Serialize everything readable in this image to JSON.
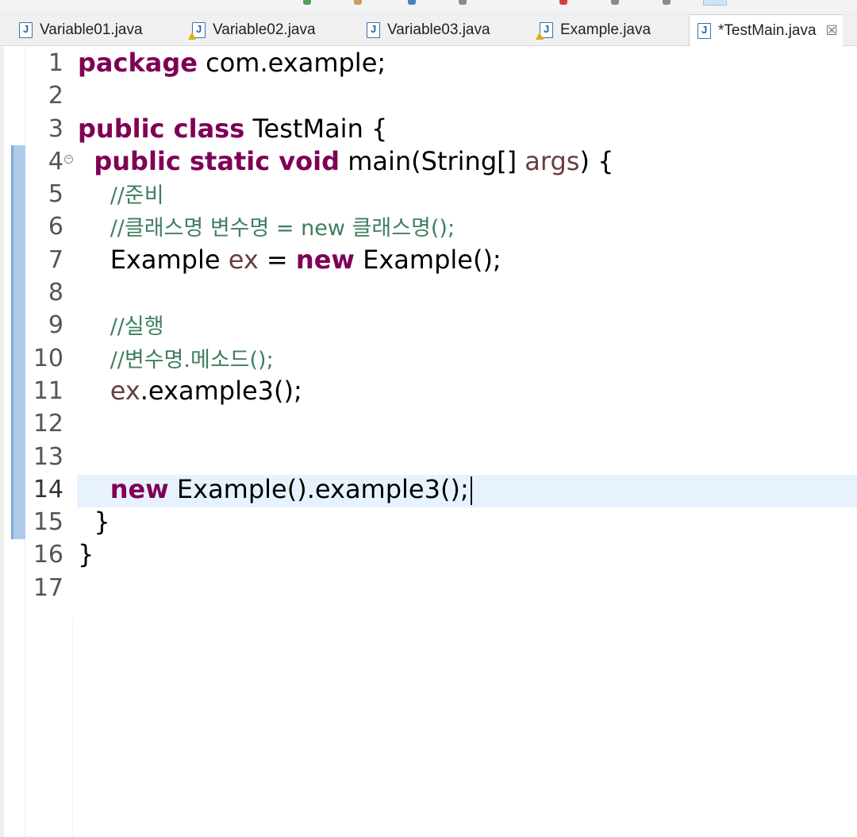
{
  "tabs": [
    {
      "label": "Variable01.java",
      "warning": false,
      "active": false
    },
    {
      "label": "Variable02.java",
      "warning": true,
      "active": false
    },
    {
      "label": "Variable03.java",
      "warning": false,
      "active": false
    },
    {
      "label": "Example.java",
      "warning": true,
      "active": false
    },
    {
      "label": "*TestMain.java",
      "warning": false,
      "active": true
    }
  ],
  "close_glyph": "☒",
  "line_numbers": [
    "1",
    "2",
    "3",
    "4",
    "5",
    "6",
    "7",
    "8",
    "9",
    "10",
    "11",
    "12",
    "13",
    "14",
    "15",
    "16",
    "17"
  ],
  "current_line": "14",
  "code": {
    "l1": {
      "kw": "package",
      "rest": " com.example;"
    },
    "l3": {
      "kw": "public class",
      "rest": " TestMain {"
    },
    "l4": {
      "kw": "public static void",
      "a": " main(String[] ",
      "var": "args",
      "b": ") {"
    },
    "l5": {
      "comment": "//준비"
    },
    "l6": {
      "comment": "//클래스명 변수명 = new 클래스명();"
    },
    "l7": {
      "a": "Example ",
      "var": "ex",
      "b": " = ",
      "kw": "new",
      "c": " Example();"
    },
    "l9": {
      "comment": "//실행"
    },
    "l10": {
      "comment": "//변수명.메소드();"
    },
    "l11": {
      "var": "ex",
      "a": ".example3();"
    },
    "l14": {
      "kw": "new",
      "a": " Example().example3();"
    },
    "l15": {
      "a": "}"
    },
    "l16": {
      "a": "}"
    }
  },
  "colors": {
    "keyword": "#7f0055",
    "comment": "#3f7f5f",
    "local_variable": "#6a3e3e",
    "current_line_highlight": "#e8f2fe",
    "change_bar": "#aecbea"
  }
}
